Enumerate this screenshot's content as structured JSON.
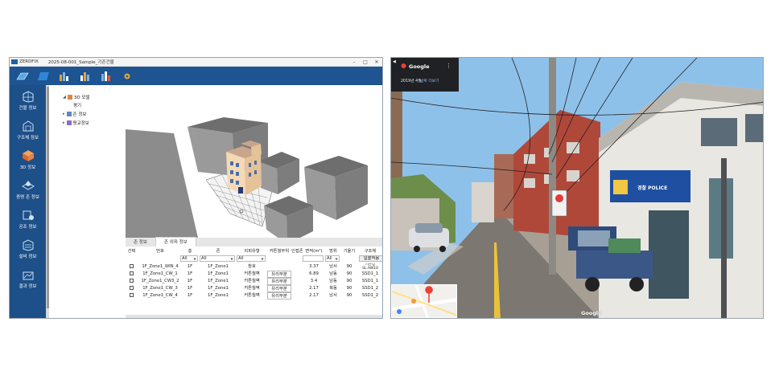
{
  "app": {
    "name": "ZERDFIX",
    "title": "2025-08-001_Sample_기존건물",
    "window_controls": [
      "–",
      "□",
      "✕"
    ],
    "ribbon_icons": [
      "floor-view-icon",
      "slab-icon",
      "bar-chart-icon",
      "bar-chart-icon",
      "bar-chart-icon",
      "settings-icon"
    ]
  },
  "sidebar": {
    "items": [
      {
        "label": "건물 정보",
        "icon": "building-icon"
      },
      {
        "label": "구조체 정보",
        "icon": "structure-icon"
      },
      {
        "label": "3D 정보",
        "icon": "cube-icon"
      },
      {
        "label": "증명 존 정보",
        "icon": "zone-icon"
      },
      {
        "label": "공조 정보",
        "icon": "hvac-icon"
      },
      {
        "label": "설비 정보",
        "icon": "equipment-icon"
      },
      {
        "label": "결과 정보",
        "icon": "result-icon"
      }
    ]
  },
  "tree": {
    "items": [
      {
        "label": "3D 모델",
        "arrow": "◢"
      },
      {
        "label": "평기",
        "arrow": ""
      },
      {
        "label": "존 정보",
        "arrow": "▸"
      },
      {
        "label": "평교정보",
        "arrow": "▸"
      }
    ]
  },
  "bottom_tabs": [
    "존 정보",
    "존 외피 정보"
  ],
  "table": {
    "columns": [
      "선택",
      "번호",
      "층",
      "존",
      "외피유형",
      "커튼월부위",
      "인접존",
      "면적(m²)",
      "방위",
      "기울기",
      "구조체"
    ],
    "filters": [
      "All",
      "All",
      "All",
      "",
      "All",
      "일괄적용"
    ],
    "rows": [
      [
        "",
        "1F_Zone1_WIN_4",
        "1F",
        "1F_Zone1",
        "창호",
        "",
        "",
        "3.37",
        "남서",
        "90",
        "기본창\nSL.AW10"
      ],
      [
        "",
        "1F_Zone1_CW_1",
        "1F",
        "1F_Zone1",
        "커튼월벽",
        "유리부분",
        "",
        "6.89",
        "남동",
        "90",
        "SSD1_1"
      ],
      [
        "",
        "1F_Zone1_CW3_2",
        "1F",
        "1F_Zone1",
        "커튼월벽",
        "유리부분",
        "",
        "3.4",
        "남동",
        "90",
        "SSD1_1"
      ],
      [
        "",
        "1F_Zone1_CW_3",
        "1F",
        "1F_Zone1",
        "커튼월벽",
        "유리부분",
        "",
        "2.17",
        "북동",
        "90",
        "SSD1_2"
      ],
      [
        "",
        "1F_Zone1_CW_4",
        "1F",
        "1F_Zone1",
        "커튼월벽",
        "유리부분",
        "",
        "2.17",
        "남서",
        "90",
        "SSD1_2"
      ]
    ]
  },
  "streetview": {
    "provider": "Google",
    "date": "2019년 4월",
    "more_dates": "날짜 더보기",
    "sign": "경찰 POLICE",
    "watermark": "Google"
  }
}
